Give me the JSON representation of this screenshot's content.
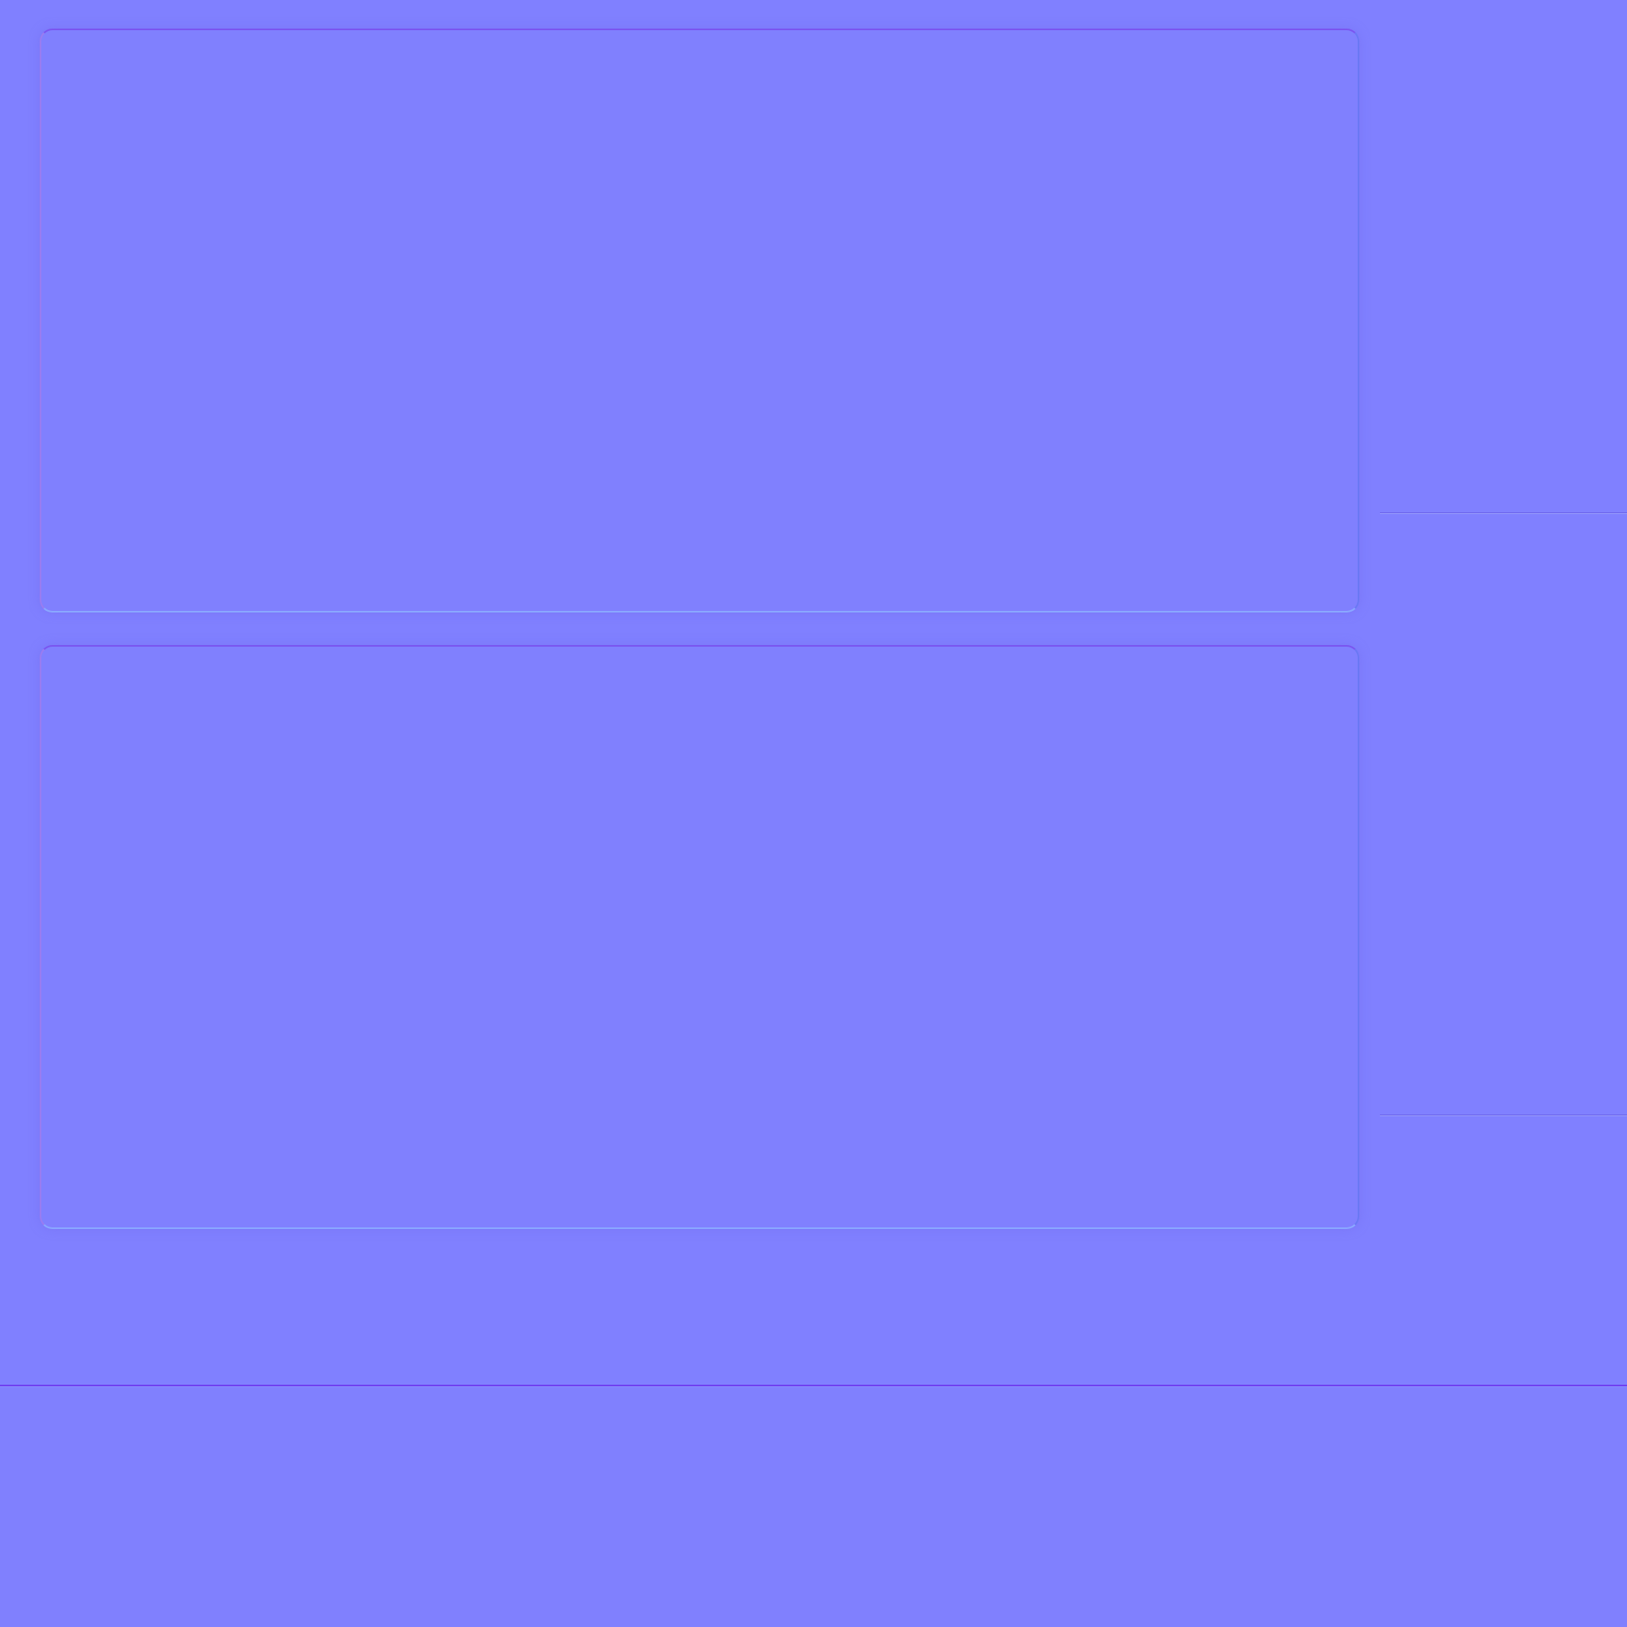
{
  "page": {
    "background_color": "#8080ff",
    "panels": [
      {
        "name": "upper-panel"
      },
      {
        "name": "lower-panel"
      }
    ],
    "accent_colors": {
      "top_edge": "#7a55f0",
      "bottom_edge": "#8aa8ff",
      "divider": "#7040f0"
    }
  }
}
